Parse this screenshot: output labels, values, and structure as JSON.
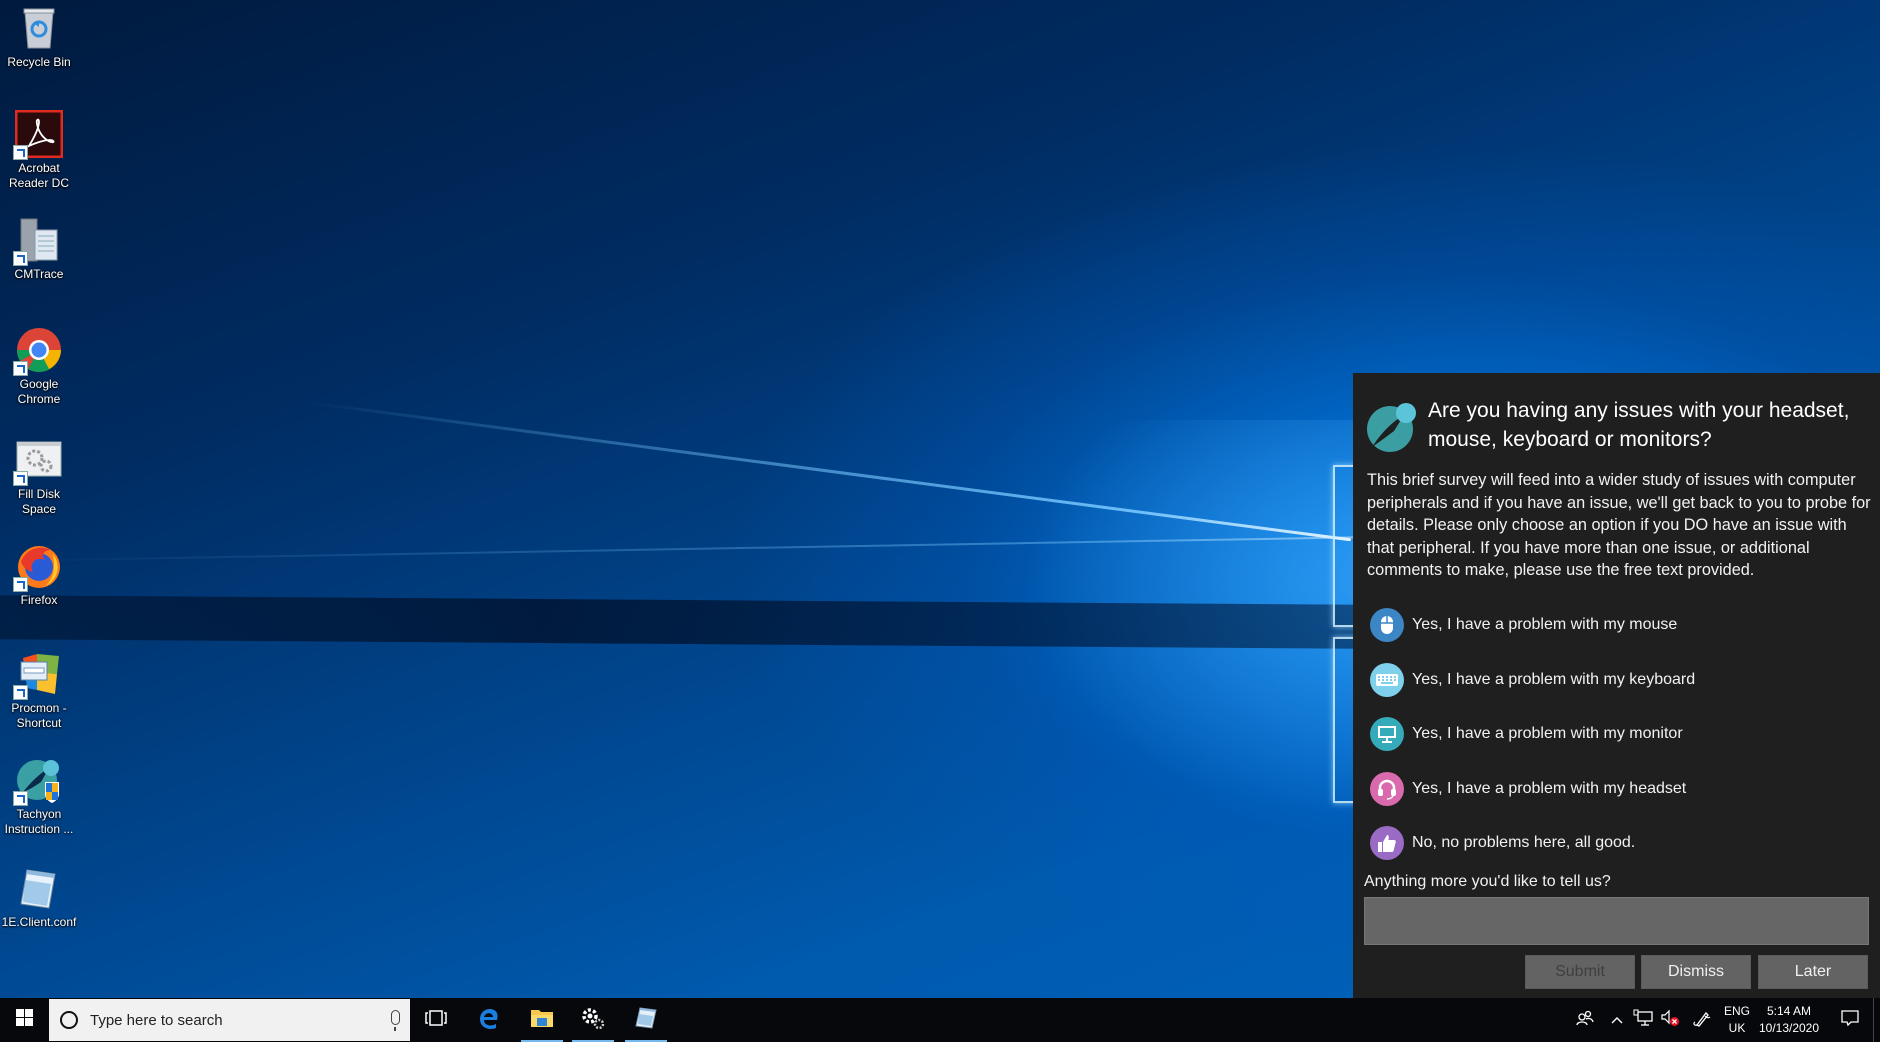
{
  "desktop": {
    "icons": [
      {
        "label": "Recycle Bin",
        "icon": "recycle-bin-icon",
        "shortcut": false
      },
      {
        "label": "Acrobat Reader DC",
        "icon": "acrobat-icon",
        "shortcut": true
      },
      {
        "label": "CMTrace",
        "icon": "cmtrace-icon",
        "shortcut": true
      },
      {
        "label": "Google Chrome",
        "icon": "chrome-icon",
        "shortcut": true
      },
      {
        "label": "Fill Disk Space",
        "icon": "gears-window-icon",
        "shortcut": true
      },
      {
        "label": "Firefox",
        "icon": "firefox-icon",
        "shortcut": true
      },
      {
        "label": "Procmon - Shortcut",
        "icon": "procmon-icon",
        "shortcut": true
      },
      {
        "label": "Tachyon Instruction ...",
        "icon": "tachyon-icon",
        "shortcut": true
      },
      {
        "label": "1E.Client.conf",
        "icon": "notepad-icon",
        "shortcut": false
      }
    ]
  },
  "survey": {
    "logo": "tachyon-logo-icon",
    "title": "Are you having any issues with your headset, mouse, keyboard or monitors?",
    "body": "This brief survey will feed into a wider study of issues with computer peripherals and if you have an issue, we'll get back to you to probe for details. Please only choose an option if you DO have an issue with that peripheral. If you have more than one issue, or additional comments to make, please use the free text provided.",
    "options": [
      {
        "label": "Yes, I have a problem with my mouse",
        "icon": "mouse-icon",
        "color": "#3d86c6"
      },
      {
        "label": "Yes, I have a problem with my keyboard",
        "icon": "keyboard-icon",
        "color": "#7fd0ea"
      },
      {
        "label": "Yes, I have a problem with my monitor",
        "icon": "monitor-icon",
        "color": "#35aab8"
      },
      {
        "label": "Yes, I have a problem with my headset",
        "icon": "headset-icon",
        "color": "#d96aae"
      },
      {
        "label": "No, no problems here, all good.",
        "icon": "thumbs-up-icon",
        "color": "#9a6bc4"
      }
    ],
    "more_label": "Anything more you'd like to tell us?",
    "more_value": "",
    "buttons": {
      "submit": "Submit",
      "dismiss": "Dismiss",
      "later": "Later"
    },
    "submit_enabled": false
  },
  "taskbar": {
    "search_placeholder": "Type here to search",
    "pinned": [
      {
        "name": "task-view",
        "running": false
      },
      {
        "name": "edge",
        "running": false
      },
      {
        "name": "file-explorer",
        "running": true
      },
      {
        "name": "settings",
        "running": true
      },
      {
        "name": "notepad",
        "running": true
      }
    ],
    "tray": {
      "language_line1": "ENG",
      "language_line2": "UK",
      "time": "5:14 AM",
      "date": "10/13/2020",
      "volume_muted": true
    }
  }
}
